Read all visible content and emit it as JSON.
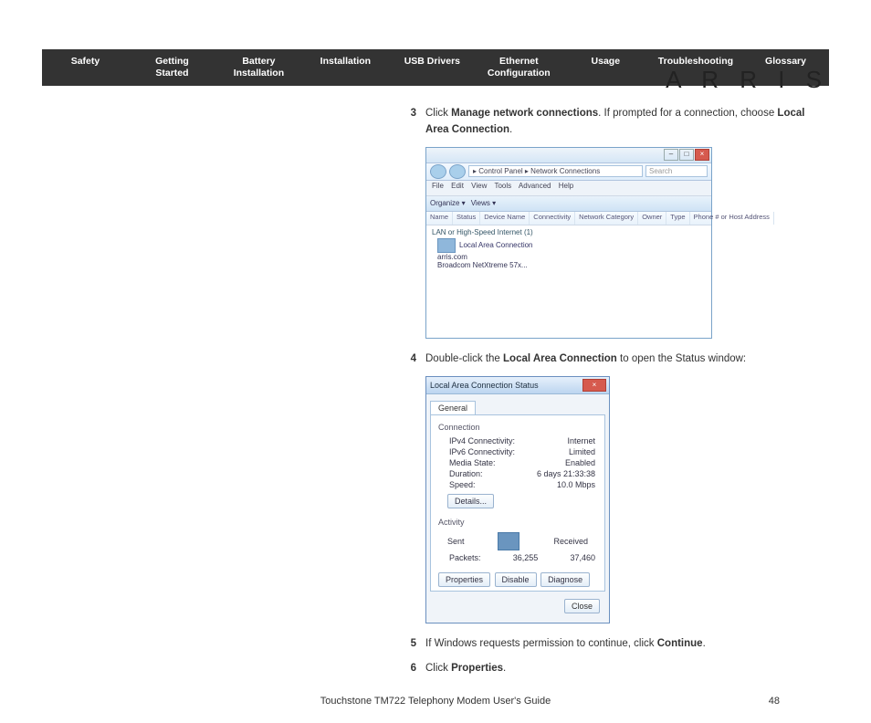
{
  "logo": "A R R I S",
  "nav": [
    "Safety",
    "Getting Started",
    "Battery Installation",
    "Installation",
    "USB Drivers",
    "Ethernet Configuration",
    "Usage",
    "Troubleshooting",
    "Glossary"
  ],
  "steps": {
    "s3": {
      "n": "3",
      "pre": "Click ",
      "b1": "Manage network connections",
      "mid": ". If prompted for a connection, choose ",
      "b2": "Local Area Connection",
      "post": "."
    },
    "s4": {
      "n": "4",
      "pre": "Double-click the ",
      "b1": "Local Area Connection",
      "post": " to open the Status window:"
    },
    "s5": {
      "n": "5",
      "pre": "If Windows requests permission to continue, click ",
      "b1": "Continue",
      "post": "."
    },
    "s6": {
      "n": "6",
      "pre": "Click ",
      "b1": "Properties",
      "post": "."
    }
  },
  "fig1": {
    "path": "▸ Control Panel ▸ Network Connections",
    "search": "Search",
    "menu": [
      "File",
      "Edit",
      "View",
      "Tools",
      "Advanced",
      "Help"
    ],
    "toolbar": [
      "Organize ▾",
      "Views ▾"
    ],
    "columns": [
      "Name",
      "Status",
      "Device Name",
      "Connectivity",
      "Network Category",
      "Owner",
      "Type",
      "Phone # or Host Address"
    ],
    "group": "LAN or High-Speed Internet (1)",
    "item_name": "Local Area Connection",
    "item_sub1": "arris.com",
    "item_sub2": "Broadcom NetXtreme 57x..."
  },
  "fig2": {
    "title": "Local Area Connection Status",
    "tab": "General",
    "sec_conn": "Connection",
    "rows_conn": [
      {
        "l": "IPv4 Connectivity:",
        "v": "Internet"
      },
      {
        "l": "IPv6 Connectivity:",
        "v": "Limited"
      },
      {
        "l": "Media State:",
        "v": "Enabled"
      },
      {
        "l": "Duration:",
        "v": "6 days 21:33:38"
      },
      {
        "l": "Speed:",
        "v": "10.0 Mbps"
      }
    ],
    "btn_details": "Details...",
    "sec_act": "Activity",
    "act_sent": "Sent",
    "act_recv": "Received",
    "packets_l": "Packets:",
    "packets_s": "36,255",
    "packets_r": "37,460",
    "btn_props": "Properties",
    "btn_disable": "Disable",
    "btn_diag": "Diagnose",
    "btn_close": "Close"
  },
  "footer": {
    "title": "Touchstone TM722 Telephony Modem User's Guide",
    "page": "48"
  }
}
